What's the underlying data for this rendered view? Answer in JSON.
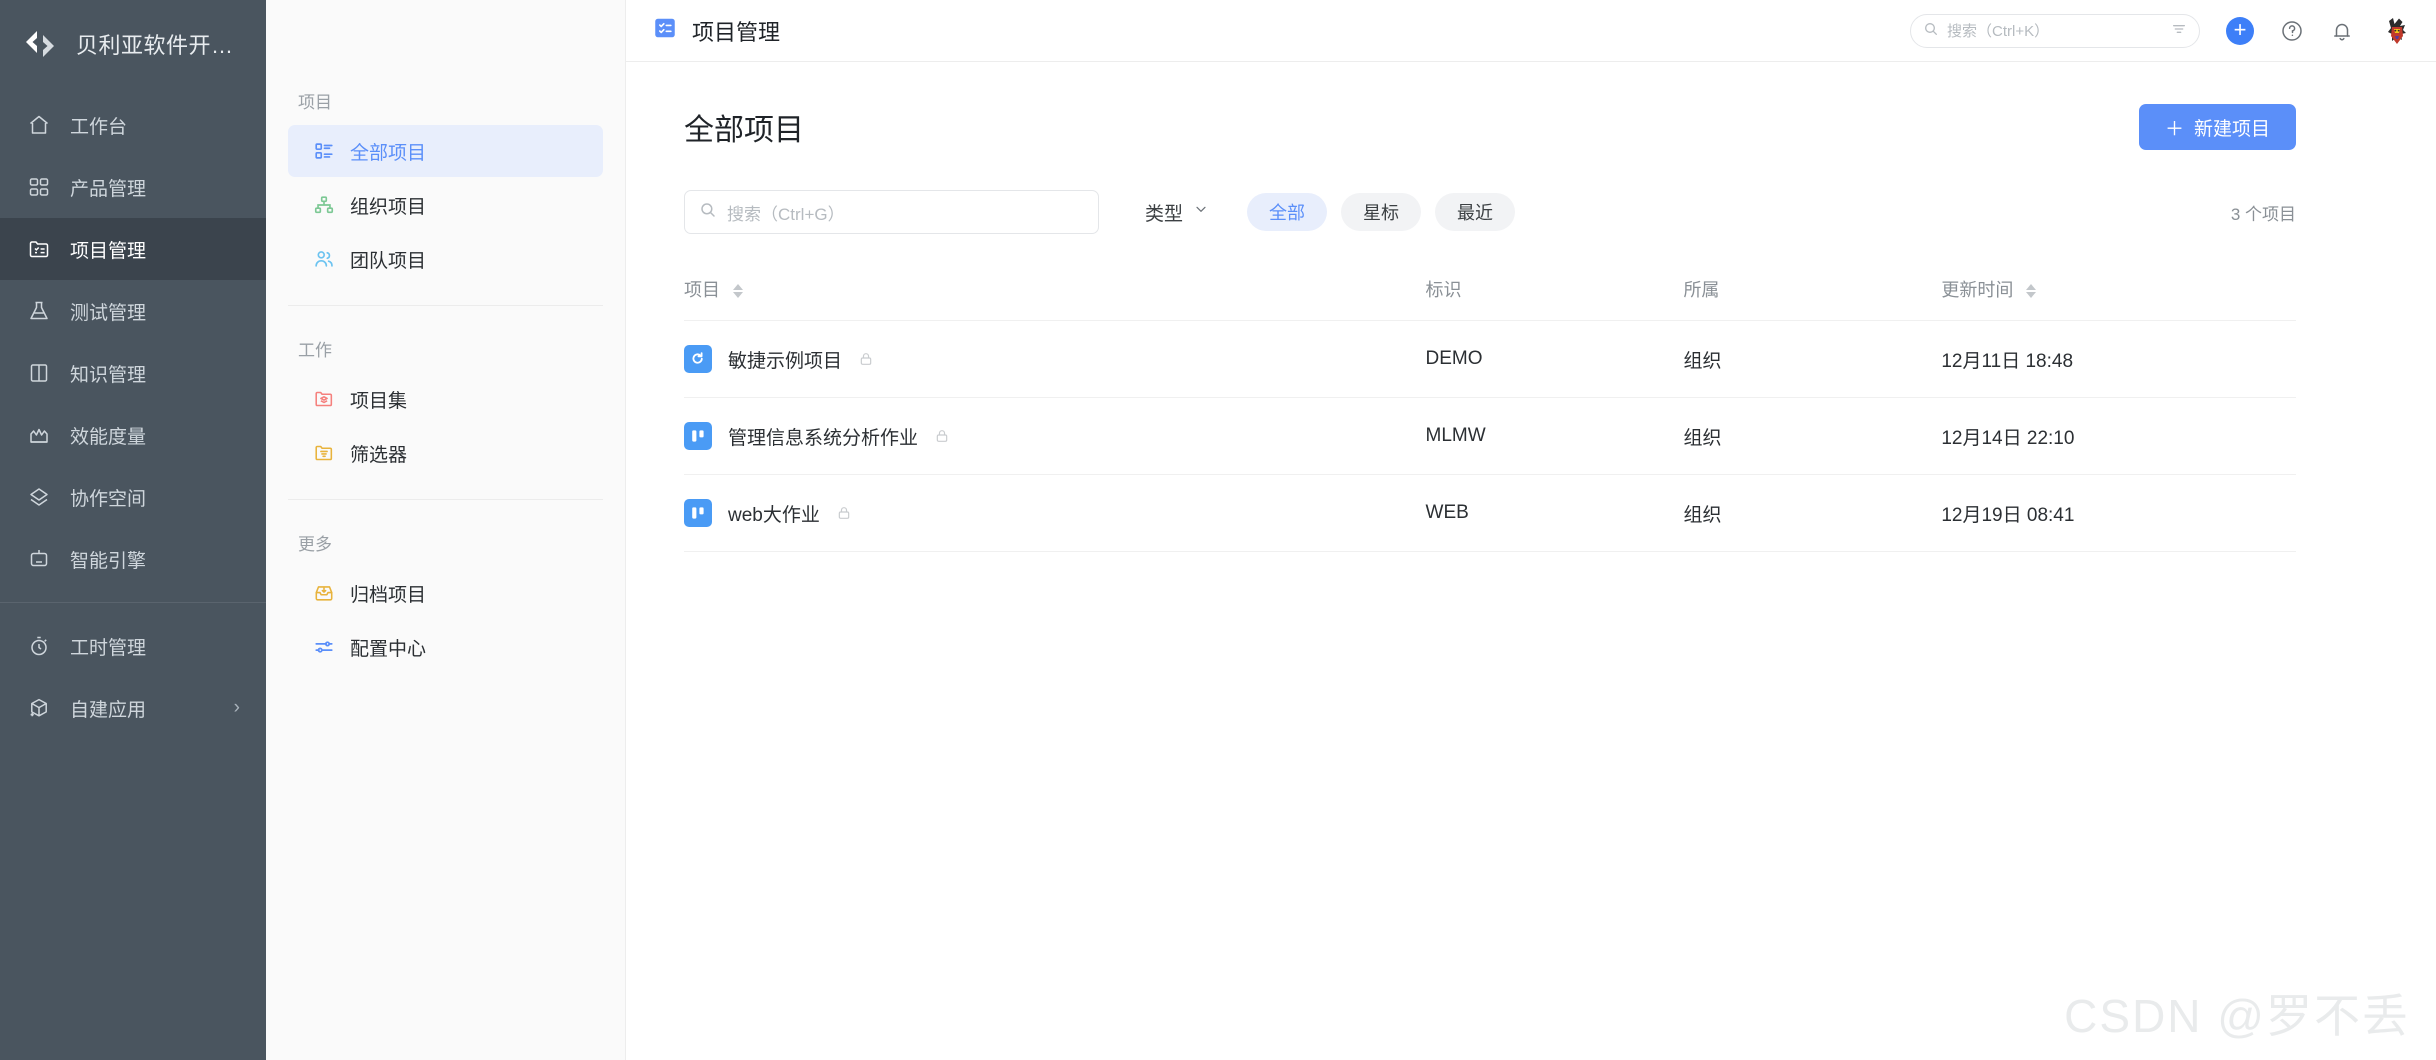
{
  "brand": {
    "logo_icon": "angle-brackets-logo",
    "name": "贝利亚软件开…"
  },
  "rail": {
    "items": [
      {
        "label": "工作台",
        "icon": "home-icon",
        "active": false
      },
      {
        "label": "产品管理",
        "icon": "grid-icon",
        "active": false
      },
      {
        "label": "项目管理",
        "icon": "project-icon",
        "active": true
      },
      {
        "label": "测试管理",
        "icon": "flask-icon",
        "active": false
      },
      {
        "label": "知识管理",
        "icon": "book-icon",
        "active": false
      },
      {
        "label": "效能度量",
        "icon": "chart-icon",
        "active": false
      },
      {
        "label": "协作空间",
        "icon": "layers-icon",
        "active": false
      },
      {
        "label": "智能引擎",
        "icon": "robot-icon",
        "active": false
      }
    ],
    "bottom_items": [
      {
        "label": "工时管理",
        "icon": "stopwatch-icon",
        "chevron": false
      },
      {
        "label": "自建应用",
        "icon": "cube-plus-icon",
        "chevron": true,
        "chevron_glyph": "›"
      }
    ]
  },
  "subnav": {
    "groups": [
      {
        "title": "项目",
        "items": [
          {
            "label": "全部项目",
            "icon": "list-blocks-icon",
            "active": true
          },
          {
            "label": "组织项目",
            "icon": "org-tree-icon",
            "active": false
          },
          {
            "label": "团队项目",
            "icon": "team-users-icon",
            "active": false
          }
        ]
      },
      {
        "title": "工作",
        "items": [
          {
            "label": "项目集",
            "icon": "folder-stack-icon",
            "active": false
          },
          {
            "label": "筛选器",
            "icon": "folder-filter-icon",
            "active": false
          }
        ]
      },
      {
        "title": "更多",
        "items": [
          {
            "label": "归档项目",
            "icon": "archive-icon",
            "active": false
          },
          {
            "label": "配置中心",
            "icon": "sliders-icon",
            "active": false
          }
        ]
      }
    ]
  },
  "topbar": {
    "icon": "project-module-icon",
    "title": "项目管理",
    "search_placeholder": "搜索（Ctrl+K）",
    "search_value": "",
    "search_icon": "search-icon",
    "filter_icon": "filter-lines-icon",
    "add_icon": "plus-circle-icon",
    "add_glyph": "+",
    "help_icon": "question-circle-icon",
    "bell_icon": "bell-icon",
    "avatar_icon": "user-avatar"
  },
  "page": {
    "title": "全部项目",
    "new_project_label": "新建项目",
    "new_project_icon": "plus-icon",
    "new_project_glyph": "＋",
    "count_label": "3 个项目"
  },
  "filters": {
    "search_placeholder": "搜索（Ctrl+G）",
    "search_value": "",
    "search_icon": "search-icon",
    "type_label": "类型",
    "type_chevron": "chevron-down-icon",
    "chips": [
      {
        "label": "全部",
        "active": true
      },
      {
        "label": "星标",
        "active": false
      },
      {
        "label": "最近",
        "active": false
      }
    ]
  },
  "table": {
    "columns": [
      {
        "label": "项目",
        "sortable": true
      },
      {
        "label": "标识",
        "sortable": false
      },
      {
        "label": "所属",
        "sortable": false
      },
      {
        "label": "更新时间",
        "sortable": true
      }
    ],
    "rows": [
      {
        "name": "敏捷示例项目",
        "icon": "project-agile-icon",
        "icon_color": "#4a9bf5",
        "locked": true,
        "lock_icon": "lock-icon",
        "key": "DEMO",
        "owner": "组织",
        "updated": "12月11日 18:48"
      },
      {
        "name": "管理信息系统分析作业",
        "icon": "project-kanban-icon",
        "icon_color": "#4a9bf5",
        "locked": true,
        "lock_icon": "lock-icon",
        "key": "MLMW",
        "owner": "组织",
        "updated": "12月14日 22:10"
      },
      {
        "name": "web大作业",
        "icon": "project-kanban-icon",
        "icon_color": "#4a9bf5",
        "locked": true,
        "lock_icon": "lock-icon",
        "key": "WEB",
        "owner": "组织",
        "updated": "12月19日 08:41"
      }
    ]
  },
  "watermark": {
    "text": "CSDN @罗不丢"
  },
  "colors": {
    "rail_bg": "#4a555f",
    "rail_active_bg": "#3b444d",
    "accent": "#5b8ff9",
    "accent_strong": "#3d7ff8",
    "chip_active_bg": "#e8eefc",
    "subnav_bg": "#fafafa"
  }
}
